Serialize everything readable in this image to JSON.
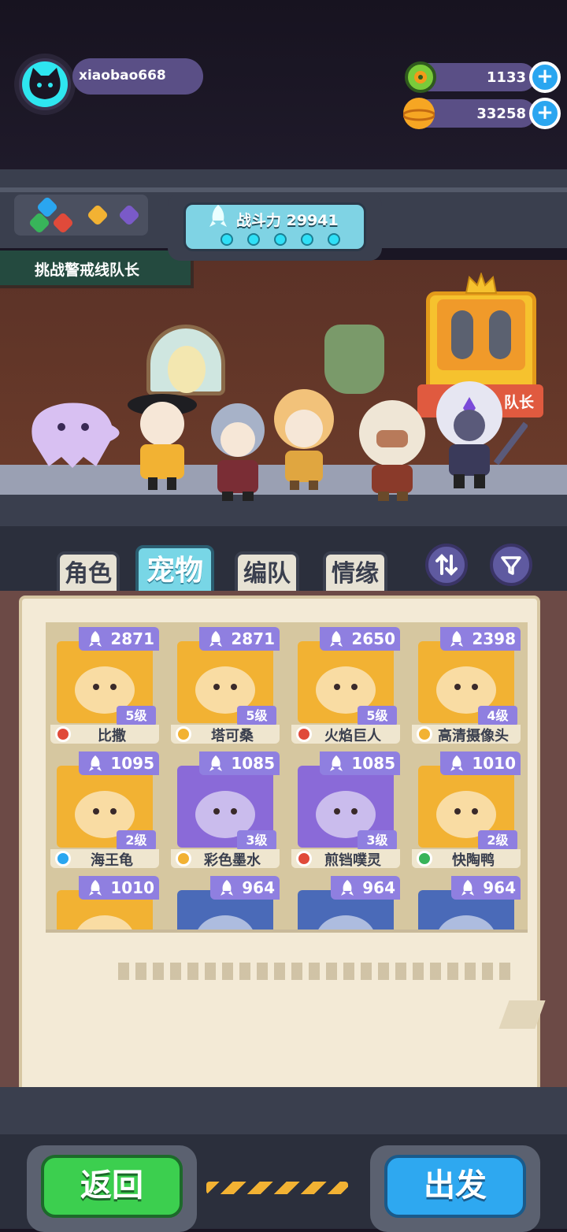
{
  "player": {
    "username": "xiaobao668"
  },
  "currency": {
    "gems": "1133",
    "coins": "33258"
  },
  "colors": {
    "accent": "#2ea8f0",
    "go_button": "#2ea8f0",
    "back_button": "#3ccf4f",
    "power_tag": "#8f7fe0"
  },
  "mission": {
    "label": "挑战警戒线队长"
  },
  "team": {
    "power_label": "战斗力 29941"
  },
  "captain": {
    "label": "队长"
  },
  "tabs": [
    {
      "label": "角色"
    },
    {
      "label": "宠物"
    },
    {
      "label": "编队"
    },
    {
      "label": "情缘"
    }
  ],
  "active_tab": "宠物",
  "pets": [
    {
      "name": "比撒",
      "power": "2871",
      "level": "5级",
      "element": "fire"
    },
    {
      "name": "塔可桑",
      "power": "2871",
      "level": "5级",
      "element": "light"
    },
    {
      "name": "火焰巨人",
      "power": "2650",
      "level": "5级",
      "element": "fire"
    },
    {
      "name": "高清摄像头",
      "power": "2398",
      "level": "4级",
      "element": "light"
    },
    {
      "name": "海王龟",
      "power": "1095",
      "level": "2级",
      "element": "water"
    },
    {
      "name": "彩色墨水",
      "power": "1085",
      "level": "3级",
      "element": "light"
    },
    {
      "name": "煎铛噗灵",
      "power": "1085",
      "level": "3级",
      "element": "fire"
    },
    {
      "name": "快陶鸭",
      "power": "1010",
      "level": "2级",
      "element": "wood"
    },
    {
      "name": "",
      "power": "1010",
      "level": "",
      "element": ""
    },
    {
      "name": "",
      "power": "964",
      "level": "",
      "element": ""
    },
    {
      "name": "",
      "power": "964",
      "level": "",
      "element": ""
    },
    {
      "name": "",
      "power": "964",
      "level": "",
      "element": ""
    }
  ],
  "buttons": {
    "back": "返回",
    "go": "出发"
  }
}
